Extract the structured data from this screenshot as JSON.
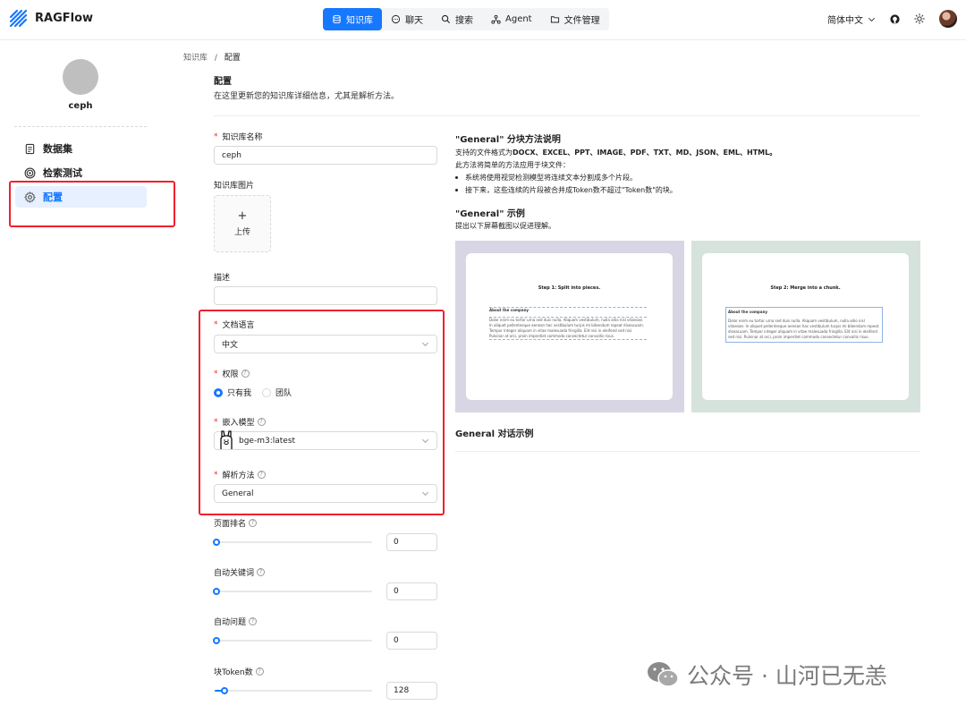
{
  "app": {
    "name": "RAGFlow"
  },
  "nav": {
    "tabs": [
      "知识库",
      "聊天",
      "搜索",
      "Agent",
      "文件管理"
    ],
    "active": 0
  },
  "header": {
    "language": "简体中文"
  },
  "sidebar": {
    "kb_name": "ceph",
    "items": [
      {
        "label": "数据集",
        "icon": "document-icon"
      },
      {
        "label": "检索测试",
        "icon": "target-icon"
      },
      {
        "label": "配置",
        "icon": "gear-icon"
      }
    ],
    "active": 2
  },
  "breadcrumb": {
    "root": "知识库",
    "sep": "/",
    "current": "配置"
  },
  "page": {
    "title": "配置",
    "description": "在这里更新您的知识库详细信息，尤其是解析方法。"
  },
  "form": {
    "name_label": "知识库名称",
    "name_value": "ceph",
    "image_label": "知识库图片",
    "upload_plus": "+",
    "upload_label": "上传",
    "desc_label": "描述",
    "desc_value": "",
    "lang_label": "文档语言",
    "lang_value": "中文",
    "perm_label": "权限",
    "perm_options": [
      "只有我",
      "团队"
    ],
    "perm_selected": 0,
    "embed_label": "嵌入模型",
    "embed_value": "bge-m3:latest",
    "parse_label": "解析方法",
    "parse_value": "General",
    "page_rank_label": "页面排名",
    "page_rank_value": "0",
    "page_rank_fraction": 0,
    "auto_kw_label": "自动关键词",
    "auto_kw_value": "0",
    "auto_kw_fraction": 0,
    "auto_q_label": "自动问题",
    "auto_q_value": "0",
    "auto_q_fraction": 0,
    "token_label": "块Token数",
    "token_value": "128",
    "token_fraction": 0.06,
    "help": "?"
  },
  "right": {
    "h1": "\"General\" 分块方法说明",
    "t1_prefix": "支持的文件格式为",
    "t1_formats": "DOCX、EXCEL、PPT、IMAGE、PDF、TXT、MD、JSON、EML、HTML。",
    "t2": "此方法将简单的方法应用于块文件：",
    "li1": "系统将使用视觉检测模型将连续文本分割成多个片段。",
    "li2": "接下来，这些连续的片段被合并成Token数不超过\"Token数\"的块。",
    "h2": "\"General\" 示例",
    "t3": "提出以下屏幕截图以促进理解。",
    "sample1_title": "Step 1: Split into pieces.",
    "sample2_title": "Step 2: Merge into a chunk.",
    "sample_heading": "About the company",
    "sample_text": "Dolor enim eu tortor urna sed duis nulla. Aliquam vestibulum, nulla odio nisl vitaesae. In aliquet pellentesque aenean hac vestibulum turpis mi bibendum repeat diseacuam. Tempor integer aliquam in vitae malesuada fringilla. Elit nisi in eleifend sed nisi. Pulvinar at orci, proin imperdiet commodo consectetur convallis risus.",
    "h3": "General 对话示例",
    "sample1_bg": "#d8d6e4",
    "sample2_bg": "#d6e3dd"
  },
  "watermark": {
    "text": "公众号 · 山河已无恙"
  },
  "colors": {
    "accent": "#1677ff",
    "highlight_box": "#f0202d"
  }
}
